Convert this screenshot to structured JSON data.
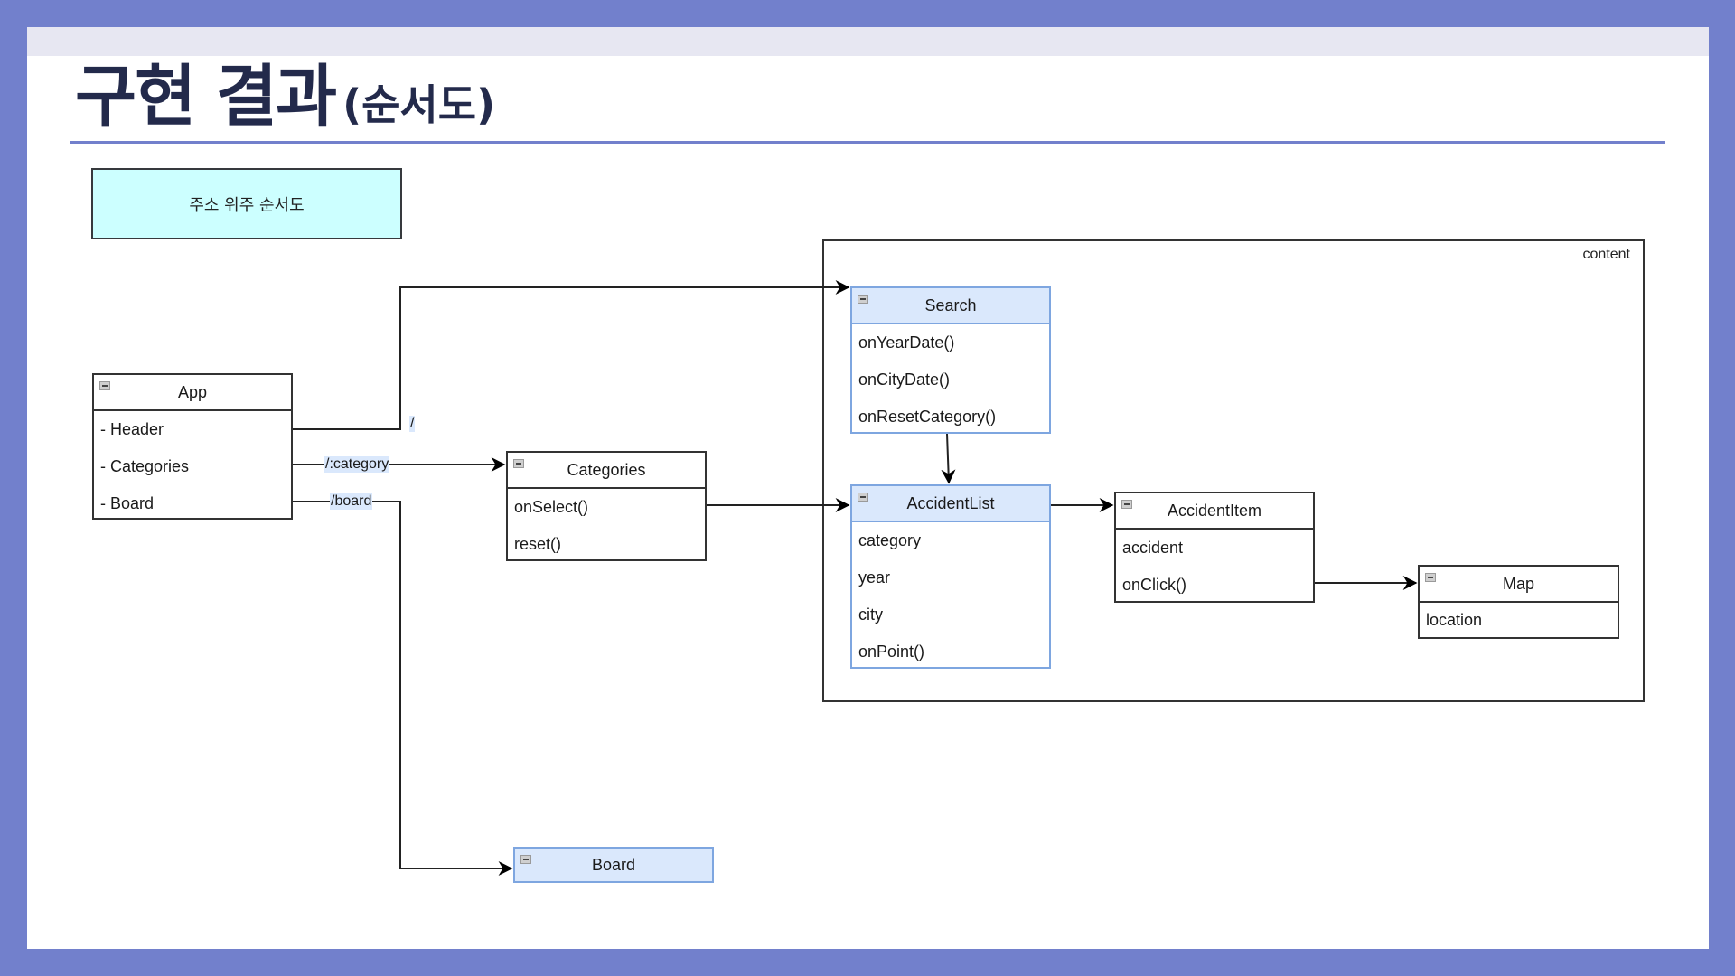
{
  "slide": {
    "title": "구현 결과",
    "subtitle": "(순서도)",
    "colors": {
      "frame": "#7280cc",
      "title": "#232a4b",
      "note_fill": "#ccffff",
      "blue_fill": "#dae8fc",
      "blue_stroke": "#7ea6e0"
    }
  },
  "note": {
    "text": "주소 위주 순서도"
  },
  "container": {
    "label": "content"
  },
  "components": {
    "app": {
      "name": "App",
      "items": [
        "- Header",
        "- Categories",
        "- Board"
      ]
    },
    "categories": {
      "name": "Categories",
      "items": [
        "onSelect()",
        "reset()"
      ]
    },
    "search": {
      "name": "Search",
      "items": [
        "onYearDate()",
        "onCityDate()",
        "onResetCategory()"
      ]
    },
    "accident_list": {
      "name": "AccidentList",
      "items": [
        "category",
        "year",
        "city",
        "onPoint()"
      ]
    },
    "accident_item": {
      "name": "AccidentItem",
      "items": [
        "accident",
        "onClick()"
      ]
    },
    "map": {
      "name": "Map",
      "items": [
        "location"
      ]
    },
    "board": {
      "name": "Board",
      "items": []
    }
  },
  "edges": [
    {
      "from": "App.Header",
      "to": "Search",
      "label": "/"
    },
    {
      "from": "App.Categories",
      "to": "Categories",
      "label": "/:category"
    },
    {
      "from": "App.Board",
      "to": "Board",
      "label": "/board"
    },
    {
      "from": "Categories",
      "to": "AccidentList",
      "label": ""
    },
    {
      "from": "Search",
      "to": "AccidentList",
      "label": ""
    },
    {
      "from": "AccidentList",
      "to": "AccidentItem",
      "label": ""
    },
    {
      "from": "AccidentItem.onClick",
      "to": "Map",
      "label": ""
    }
  ]
}
